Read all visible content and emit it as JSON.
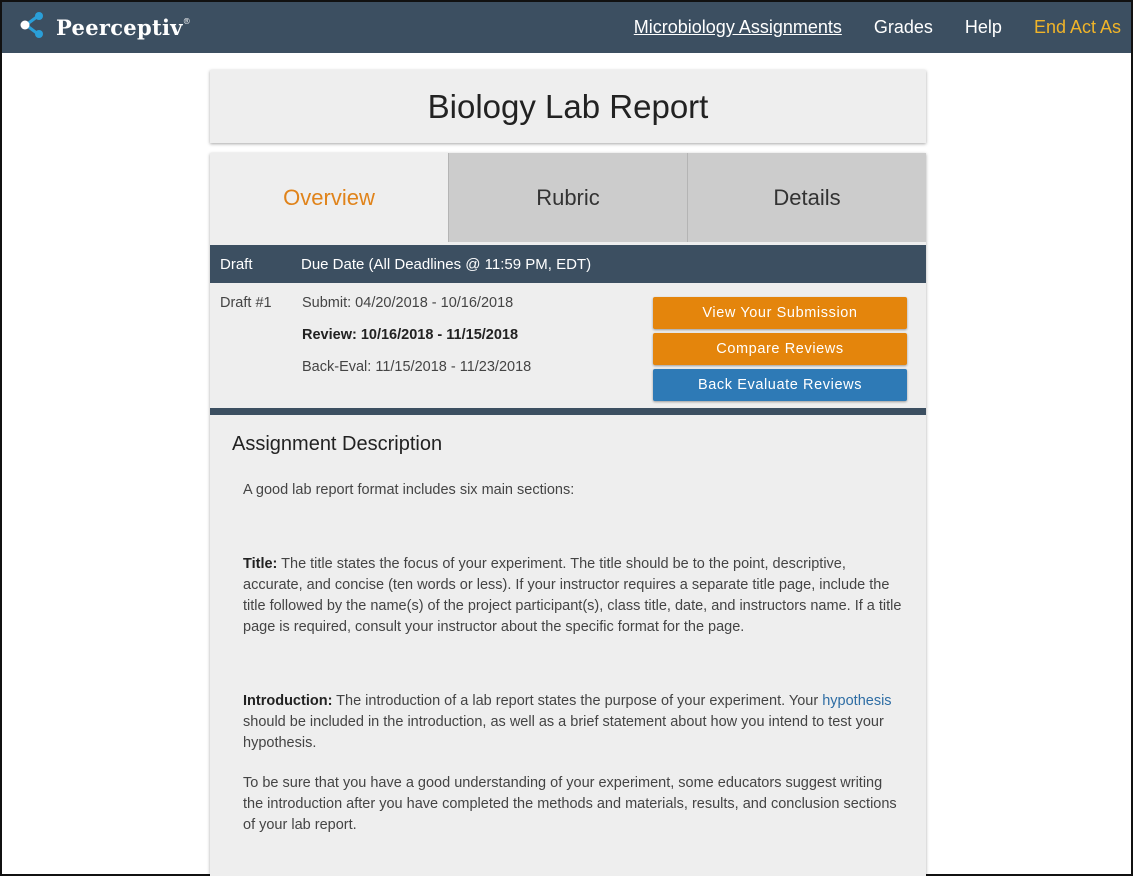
{
  "nav": {
    "brand": "Peerceptiv",
    "brand_mark": "®",
    "links": [
      "Microbiology Assignments",
      "Grades",
      "Help"
    ],
    "end_act_as": "End Act As",
    "end_act_as_color": "#f0b429"
  },
  "page": {
    "title": "Biology Lab Report"
  },
  "tabs": [
    {
      "label": "Overview",
      "active": true
    },
    {
      "label": "Rubric",
      "active": false
    },
    {
      "label": "Details",
      "active": false
    }
  ],
  "schedule": {
    "header": {
      "col1": "Draft",
      "col2": "Due Date (All Deadlines @ 11:59 PM, EDT)"
    },
    "draft_label": "Draft #1",
    "submit": "Submit: 04/20/2018 - 10/16/2018",
    "review": "Review: 10/16/2018 - 11/15/2018",
    "back_eval": "Back-Eval: 11/15/2018 - 11/23/2018"
  },
  "buttons": {
    "view_submission": "View Your Submission",
    "compare_reviews": "Compare Reviews",
    "back_evaluate": "Back Evaluate Reviews"
  },
  "colors": {
    "nav_bg": "#3c4f61",
    "accent_orange": "#e4850c",
    "accent_blue": "#2e7ab6"
  },
  "description": {
    "heading": "Assignment Description",
    "intro": "A good lab report format includes six main sections:",
    "title_label": "Title:",
    "title_text": " The title states the focus of your experiment. The title should be to the point, descriptive, accurate, and concise (ten words or less). If your instructor requires a separate title page, include the title followed by the name(s) of the project participant(s), class title, date, and instructors name. If a title page is required, consult your instructor about the specific format for the page.",
    "intro_label": "Introduction:",
    "intro_text_1": " The introduction of a lab report states the purpose of your experiment. Your ",
    "hypothesis_link": "hypothesis",
    "intro_text_2": " should be included in the introduction, as well as a brief statement about how you intend to test your hypothesis.",
    "understanding": "To be sure that you have a good understanding of your experiment, some educators suggest writing the introduction after you have completed the methods and materials, results, and conclusion sections of your lab report."
  }
}
